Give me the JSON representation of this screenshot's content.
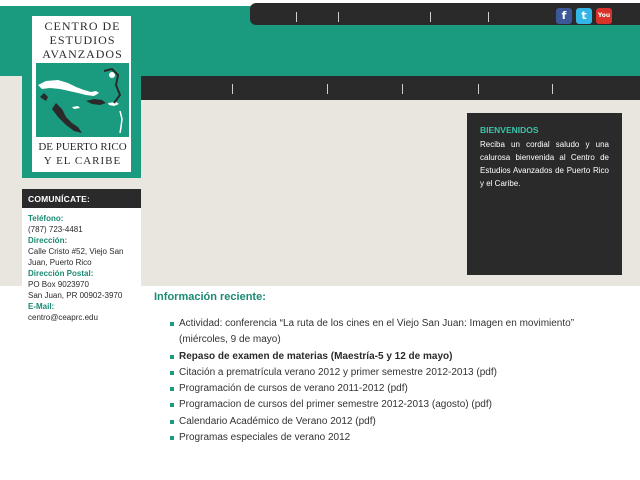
{
  "logo": {
    "line1": "CENTRO DE",
    "line2": "ESTUDIOS",
    "line3": "AVANZADOS",
    "line4": "DE PUERTO RICO",
    "line5": "Y EL CARIBE"
  },
  "social": {
    "facebook": "f",
    "twitter": "t",
    "youtube": "You"
  },
  "contact": {
    "header": "COMUNÍCATE:",
    "phone_label": "Teléfono:",
    "phone": "(787) 723-4481",
    "address_label": "Dirección:",
    "address_line1": "Calle Cristo #52, Viejo San",
    "address_line2": "Juan, Puerto Rico",
    "postal_label": "Dirección Postal:",
    "postal_line1": "PO Box 9023970",
    "postal_line2": "San Juan, PR 00902-3970",
    "email_label": "E-Mail:",
    "email": "centro@ceaprc.edu"
  },
  "welcome": {
    "title": "BIENVENIDOS",
    "text": "Reciba un cordial saludo y una calurosa bienvenida al Centro de Estudios Avanzados de Puerto Rico y el Caribe."
  },
  "recent": {
    "title": "Información reciente:",
    "items": [
      {
        "text": "Actividad: conferencia “La ruta de los cines en el Viejo San Juan: Imagen en movimiento” (miércoles, 9 de mayo)"
      },
      {
        "text": "Repaso de examen de materias (Maestría-5 y 12 de mayo)"
      },
      {
        "text": "Citación a prematrícula verano 2012 y primer semestre 2012-2013 (pdf)"
      },
      {
        "text": "Programación de cursos de verano 2011-2012 (pdf)"
      },
      {
        "text": "Programacion de cursos del primer semestre 2012-2013 (agosto) (pdf)"
      },
      {
        "text": "Calendario Académico de Verano 2012 (pdf)"
      },
      {
        "text": "Programas especiales de verano 2012"
      }
    ]
  },
  "colors": {
    "teal": "#1a9a7f",
    "dark": "#2b2a2a",
    "grey": "#e8e6df",
    "accent_text": "#1a8a73",
    "welcome_title": "#3cc4a8",
    "facebook": "#3b5998",
    "twitter": "#33b5e5",
    "youtube": "#d9322b"
  }
}
